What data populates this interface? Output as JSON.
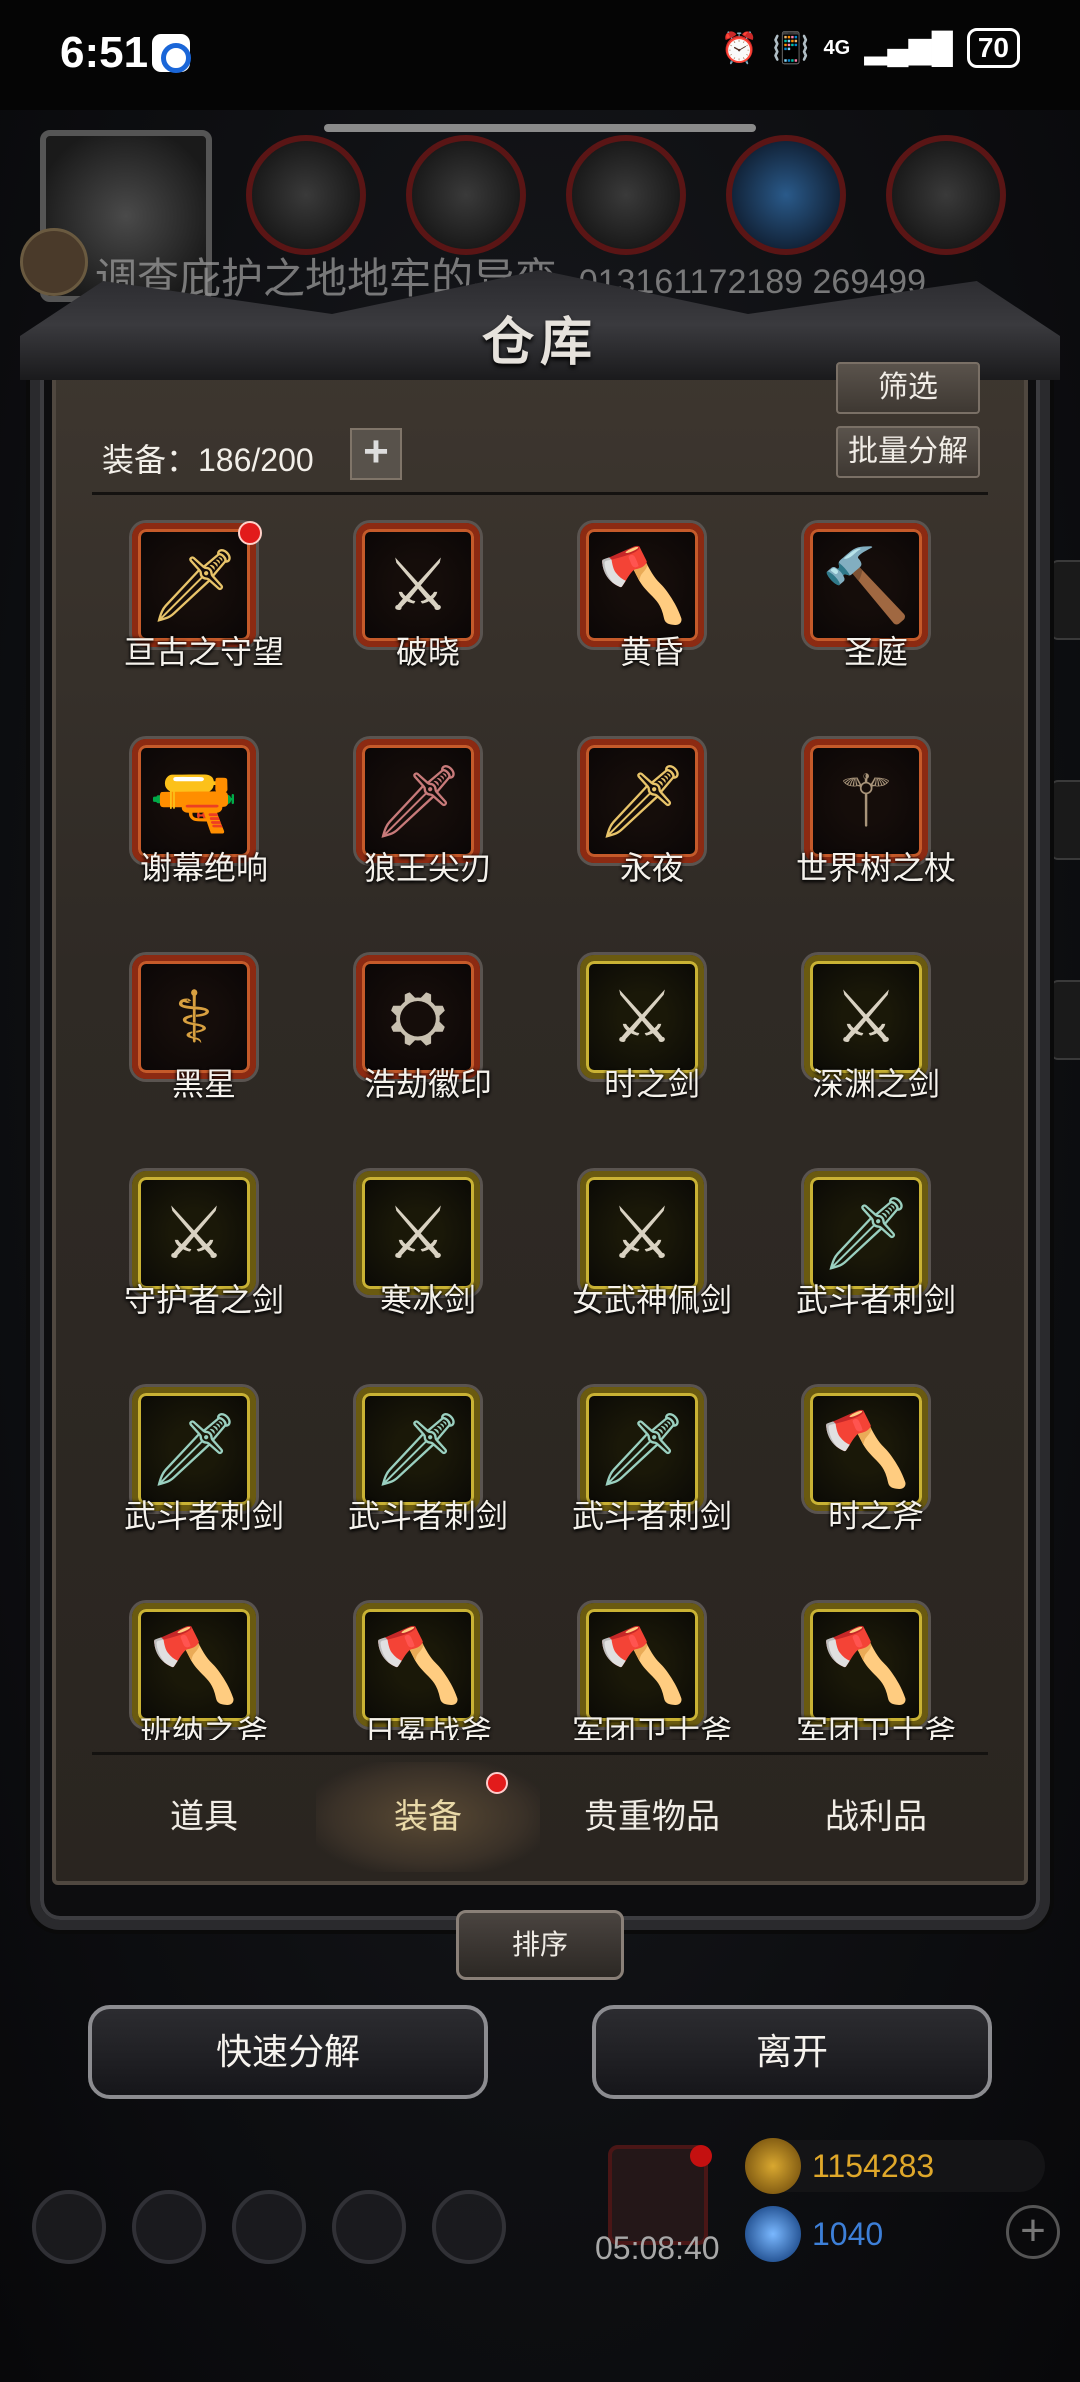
{
  "status_bar": {
    "time": "6:51",
    "network": "4G",
    "battery": "70"
  },
  "background": {
    "quest_text": "调查庇护之地地牢的异变",
    "quest_id": "013161172189 269499"
  },
  "warehouse": {
    "title": "仓库",
    "filter_label": "筛选",
    "batch_label": "批量分解",
    "count_label": "装备：186/200",
    "plus_label": "+",
    "items": [
      {
        "name": "亘古之守望",
        "rarity": "red",
        "icon": "dagger-icon",
        "new": true
      },
      {
        "name": "破晓",
        "rarity": "red",
        "icon": "sword-icon",
        "new": false
      },
      {
        "name": "黄昏",
        "rarity": "red",
        "icon": "axe-icon",
        "new": false
      },
      {
        "name": "圣庭",
        "rarity": "red",
        "icon": "hammer-icon",
        "new": false
      },
      {
        "name": "谢幕绝响",
        "rarity": "red",
        "icon": "revolver-icon",
        "new": false
      },
      {
        "name": "狼王尖刃",
        "rarity": "red",
        "icon": "blade-icon",
        "new": false
      },
      {
        "name": "永夜",
        "rarity": "red",
        "icon": "dagger-icon",
        "new": false
      },
      {
        "name": "世界树之杖",
        "rarity": "red",
        "icon": "staff-icon",
        "new": false
      },
      {
        "name": "黑星",
        "rarity": "red",
        "icon": "scepter-icon",
        "new": false
      },
      {
        "name": "浩劫徽印",
        "rarity": "red",
        "icon": "emblem-icon",
        "new": false
      },
      {
        "name": "时之剑",
        "rarity": "gold",
        "icon": "sword-icon",
        "new": false
      },
      {
        "name": "深渊之剑",
        "rarity": "gold",
        "icon": "sword-icon",
        "new": false
      },
      {
        "name": "守护者之剑",
        "rarity": "gold",
        "icon": "sword-icon",
        "new": false
      },
      {
        "name": "寒冰剑",
        "rarity": "gold",
        "icon": "sword-icon",
        "new": false
      },
      {
        "name": "女武神佩剑",
        "rarity": "gold",
        "icon": "sword-icon",
        "new": false
      },
      {
        "name": "武斗者刺剑",
        "rarity": "gold",
        "icon": "rapier-icon",
        "new": false
      },
      {
        "name": "武斗者刺剑",
        "rarity": "gold",
        "icon": "rapier-icon",
        "new": false
      },
      {
        "name": "武斗者刺剑",
        "rarity": "gold",
        "icon": "rapier-icon",
        "new": false
      },
      {
        "name": "武斗者刺剑",
        "rarity": "gold",
        "icon": "rapier-icon",
        "new": false
      },
      {
        "name": "时之斧",
        "rarity": "gold",
        "icon": "axe-icon",
        "new": false
      },
      {
        "name": "班纳之斧",
        "rarity": "gold",
        "icon": "axe-icon",
        "new": false
      },
      {
        "name": "日冕战斧",
        "rarity": "gold",
        "icon": "axe-icon",
        "new": false
      },
      {
        "name": "军团卫士斧",
        "rarity": "gold",
        "icon": "axe-icon",
        "new": false
      },
      {
        "name": "军团卫士斧",
        "rarity": "gold",
        "icon": "axe-icon",
        "new": false
      }
    ],
    "tabs": [
      {
        "label": "道具",
        "active": false
      },
      {
        "label": "装备",
        "active": true
      },
      {
        "label": "贵重物品",
        "active": false
      },
      {
        "label": "战利品",
        "active": false
      }
    ],
    "sort_label": "排序",
    "quick_decompose_label": "快速分解",
    "leave_label": "离开"
  },
  "hud": {
    "timer": "05:08:40",
    "gold": "1154283",
    "gems": "1040"
  },
  "colors": {
    "red_frame": "#8c2a12",
    "gold_frame": "#c9b234",
    "gold_text": "#e0a82a",
    "gem_text": "#3d7fd8"
  }
}
